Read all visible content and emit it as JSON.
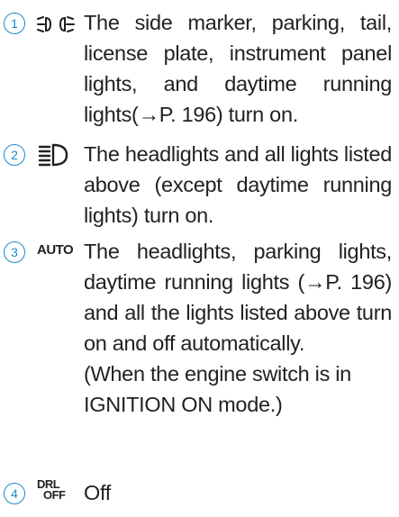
{
  "accent_color": "#1b8ac9",
  "items": [
    {
      "number": "1",
      "icon": "side-marker-lights-icon",
      "text": "The side marker, parking, tail, license plate, instrument panel lights, and daytime running lights(→P. 196) turn on."
    },
    {
      "number": "2",
      "icon": "headlights-icon",
      "text": "The headlights and all lights listed above (except daytime running lights) turn on."
    },
    {
      "number": "3",
      "icon": "auto-icon",
      "icon_label": "AUTO",
      "text": "The headlights, parking lights, daytime running lights (→P. 196) and all the lights listed above turn on and off automatically.",
      "note": "(When the engine switch is in IGNITION ON mode.)"
    },
    {
      "number": "4",
      "icon": "drl-off-icon",
      "icon_label_top": "DRL",
      "icon_label_bottom": "OFF",
      "text": "Off"
    }
  ]
}
